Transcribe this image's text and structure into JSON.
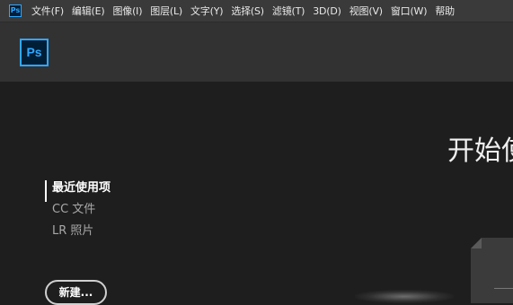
{
  "menubar": {
    "app_icon": "Ps",
    "items": [
      {
        "label": "文件(F)"
      },
      {
        "label": "编辑(E)"
      },
      {
        "label": "图像(I)"
      },
      {
        "label": "图层(L)"
      },
      {
        "label": "文字(Y)"
      },
      {
        "label": "选择(S)"
      },
      {
        "label": "滤镜(T)"
      },
      {
        "label": "3D(D)"
      },
      {
        "label": "视图(V)"
      },
      {
        "label": "窗口(W)"
      },
      {
        "label": "帮助"
      }
    ]
  },
  "header": {
    "logo_text": "Ps"
  },
  "main": {
    "title": "开始使",
    "sidebar": {
      "items": [
        {
          "label": "最近使用项"
        },
        {
          "label": "CC 文件"
        },
        {
          "label": "LR 照片"
        }
      ]
    },
    "new_button_label": "新建..."
  },
  "colors": {
    "menubar_bg": "#3a3a3a",
    "header_bg": "#323232",
    "main_bg": "#1e1e1e",
    "ps_accent": "#31a8ff",
    "ps_logo_bg": "#001e36"
  }
}
